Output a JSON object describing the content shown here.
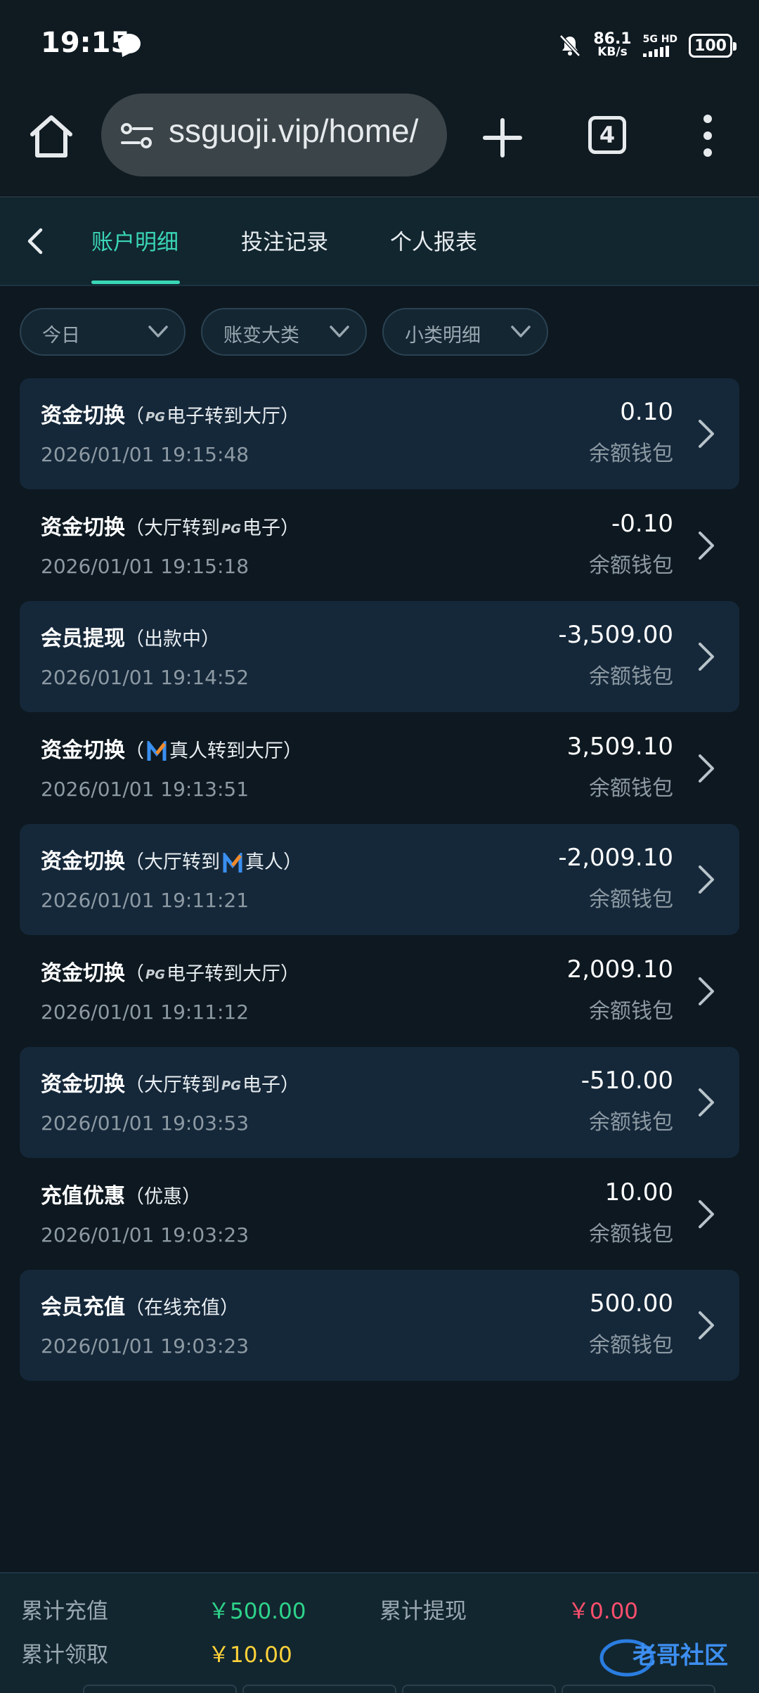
{
  "status_bar": {
    "time": "19:15",
    "speed_value": "86.1",
    "speed_unit": "KB/s",
    "network": "5G HD",
    "battery": "100"
  },
  "browser": {
    "url": "ssguoji.vip/home/",
    "tab_count": "4"
  },
  "nav": {
    "tabs": [
      {
        "label": "账户明细",
        "active": true
      },
      {
        "label": "投注记录",
        "active": false
      },
      {
        "label": "个人报表",
        "active": false
      }
    ]
  },
  "filters": [
    {
      "label": "今日"
    },
    {
      "label": "账变大类"
    },
    {
      "label": "小类明细"
    }
  ],
  "records": [
    {
      "title": "资金切换",
      "sub_open": "（",
      "logo": "pg",
      "sub_text": "电子转到大厅）",
      "time": "2026/01/01 19:15:48",
      "amount": "0.10",
      "wallet": "余额钱包"
    },
    {
      "title": "资金切换",
      "sub_open": "（大厅转到",
      "logo": "pg",
      "sub_text": "电子）",
      "time": "2026/01/01 19:15:18",
      "amount": "-0.10",
      "wallet": "余额钱包"
    },
    {
      "title": "会员提现",
      "sub_open": "（出款中）",
      "logo": "",
      "sub_text": "",
      "time": "2026/01/01 19:14:52",
      "amount": "-3,509.00",
      "wallet": "余额钱包"
    },
    {
      "title": "资金切换",
      "sub_open": "（",
      "logo": "m",
      "sub_text": "真人转到大厅）",
      "time": "2026/01/01 19:13:51",
      "amount": "3,509.10",
      "wallet": "余额钱包"
    },
    {
      "title": "资金切换",
      "sub_open": "（大厅转到",
      "logo": "m",
      "sub_text": "真人）",
      "time": "2026/01/01 19:11:21",
      "amount": "-2,009.10",
      "wallet": "余额钱包"
    },
    {
      "title": "资金切换",
      "sub_open": "（",
      "logo": "pg",
      "sub_text": "电子转到大厅）",
      "time": "2026/01/01 19:11:12",
      "amount": "2,009.10",
      "wallet": "余额钱包"
    },
    {
      "title": "资金切换",
      "sub_open": "（大厅转到",
      "logo": "pg",
      "sub_text": "电子）",
      "time": "2026/01/01 19:03:53",
      "amount": "-510.00",
      "wallet": "余额钱包"
    },
    {
      "title": "充值优惠",
      "sub_open": "（优惠）",
      "logo": "",
      "sub_text": "",
      "time": "2026/01/01 19:03:23",
      "amount": "10.00",
      "wallet": "余额钱包"
    },
    {
      "title": "会员充值",
      "sub_open": "（在线充值）",
      "logo": "",
      "sub_text": "",
      "time": "2026/01/01 19:03:23",
      "amount": "500.00",
      "wallet": "余额钱包"
    }
  ],
  "summary": {
    "recharge_label": "累计充值",
    "recharge_value": "￥500.00",
    "withdraw_label": "累计提现",
    "withdraw_value": "￥0.00",
    "claim_label": "累计领取",
    "claim_value": "￥10.00",
    "watermark": "老哥社区"
  },
  "colors": {
    "accent": "#3ad6b7",
    "positive": "#2ed38a",
    "negative": "#ff4f6d",
    "claim": "#ffd23a"
  }
}
